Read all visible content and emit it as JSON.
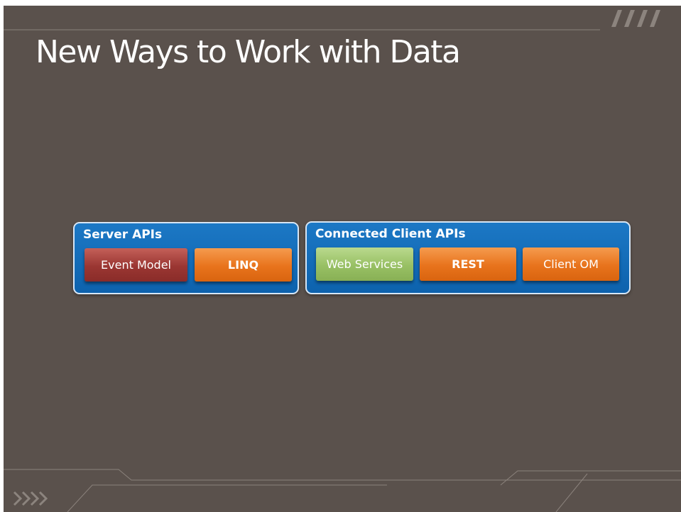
{
  "slide": {
    "title": "New Ways to Work with Data",
    "background_color": "#5a514c"
  },
  "groups": [
    {
      "label": "Server APIs",
      "color": "#1069b7",
      "items": [
        {
          "label": "Event Model",
          "color": "#9c3833"
        },
        {
          "label": "LINQ",
          "color": "#e8731c"
        }
      ]
    },
    {
      "label": "Connected Client APIs",
      "color": "#1069b7",
      "items": [
        {
          "label": "Web Services",
          "color": "#98c064"
        },
        {
          "label": "REST",
          "color": "#e8731c"
        },
        {
          "label": "Client OM",
          "color": "#e8731c"
        }
      ]
    }
  ],
  "decoration": {
    "top_right_icon": "slash-stripes-icon",
    "bottom_left_icon": "chevron-arrows-icon"
  }
}
